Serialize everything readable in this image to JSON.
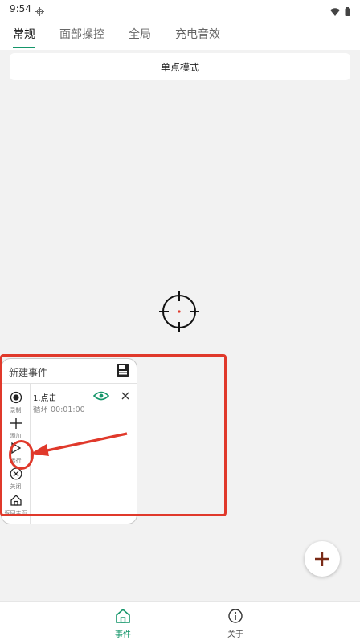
{
  "status_bar": {
    "time": "9:54"
  },
  "tabs": [
    {
      "label": "常规",
      "active": true
    },
    {
      "label": "面部操控",
      "active": false
    },
    {
      "label": "全局",
      "active": false
    },
    {
      "label": "充电音效",
      "active": false
    }
  ],
  "mode_bar": {
    "label": "单点模式"
  },
  "panel": {
    "title": "新建事件",
    "side_buttons": [
      {
        "label": "录制",
        "icon": "record-icon"
      },
      {
        "label": "添加",
        "icon": "plus-icon"
      },
      {
        "label": "运行",
        "icon": "play-icon"
      },
      {
        "label": "关闭",
        "icon": "close-circle-icon"
      },
      {
        "label": "返回主页",
        "icon": "home-icon"
      }
    ],
    "event": {
      "title": "1.点击",
      "subtitle": "循环 00:01:00"
    }
  },
  "bottom_nav": [
    {
      "label": "事件",
      "icon": "home-icon",
      "active": true
    },
    {
      "label": "关于",
      "icon": "info-icon",
      "active": false
    }
  ],
  "colors": {
    "accent": "#15966a",
    "annotation": "#e0392b",
    "fab_plus": "#7a2a16"
  }
}
